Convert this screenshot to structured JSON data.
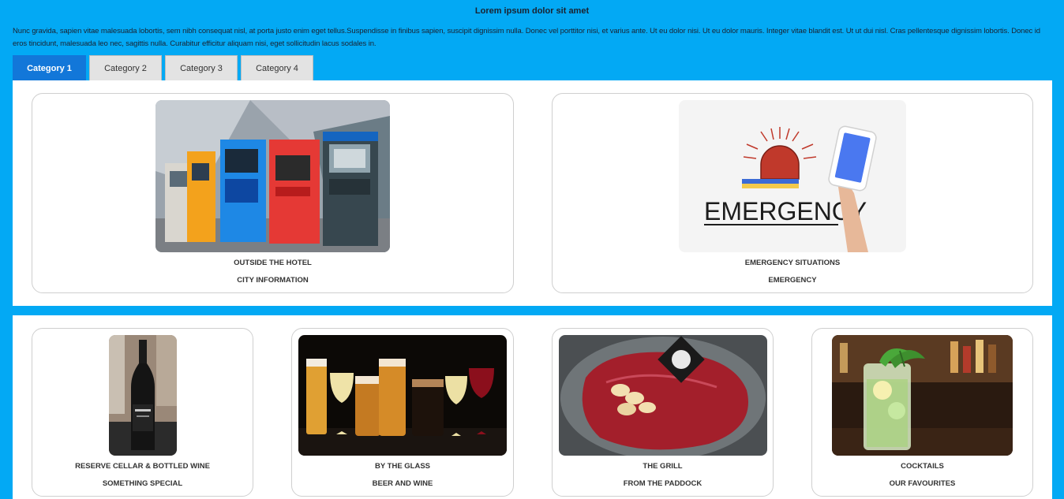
{
  "header": {
    "title": "Lorem ipsum dolor sit amet",
    "intro": "Nunc gravida, sapien vitae malesuada lobortis, sem nibh consequat nisl, at porta justo enim eget tellus.Suspendisse in finibus sapien, suscipit dignissim nulla. Donec vel porttitor nisi, et varius ante. Ut eu dolor nisi. Ut eu dolor mauris. Integer vitae blandit est. Ut ut dui nisl. Cras pellentesque dignissim lobortis. Donec id eros tincidunt, malesuada leo nec, sagittis nulla. Curabitur efficitur aliquam nisi, eget sollicitudin lacus sodales in."
  },
  "tabs": [
    {
      "label": "Category 1",
      "active": true
    },
    {
      "label": "Category 2",
      "active": false
    },
    {
      "label": "Category 3",
      "active": false
    },
    {
      "label": "Category 4",
      "active": false
    }
  ],
  "panel1": {
    "cards": [
      {
        "title": "OUTSIDE THE HOTEL",
        "subtitle": "CITY INFORMATION",
        "image": "atm-machines"
      },
      {
        "title": "EMERGENCY SITUATIONS",
        "subtitle": "EMERGENCY",
        "image": "emergency-illustration",
        "image_text": "EMERGENCY"
      }
    ]
  },
  "panel2": {
    "cards": [
      {
        "title": "RESERVE CELLAR & BOTTLED WINE",
        "subtitle": "SOMETHING SPECIAL",
        "image": "wine-bottle"
      },
      {
        "title": "BY THE GLASS",
        "subtitle": "BEER AND WINE",
        "image": "beer-and-wine-glasses"
      },
      {
        "title": "THE GRILL",
        "subtitle": "FROM THE PADDOCK",
        "image": "raw-steak"
      },
      {
        "title": "COCKTAILS",
        "subtitle": "OUR FAVOURITES",
        "image": "mojito-cocktail"
      }
    ]
  },
  "colors": {
    "page_bg": "#03a9f4",
    "active_tab": "#1277d9",
    "inactive_tab": "#e3e3e3"
  }
}
